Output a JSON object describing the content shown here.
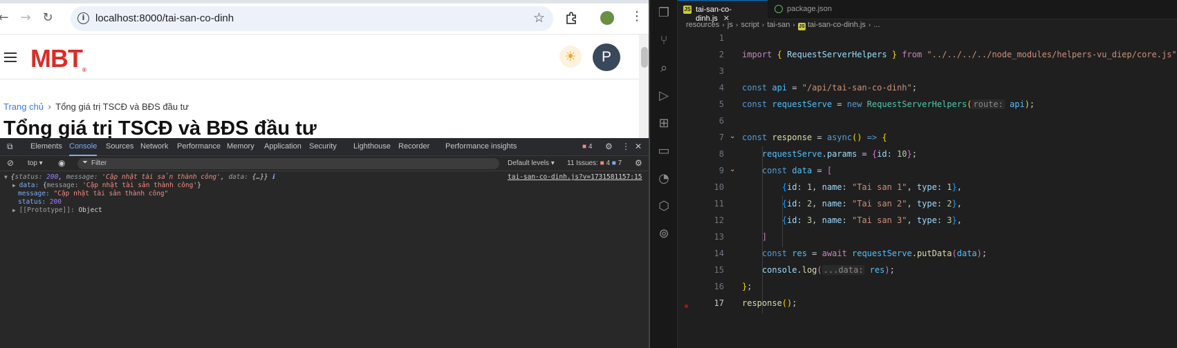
{
  "browser": {
    "url": "localhost:8000/tai-san-co-dinh",
    "page": {
      "logo_text": "MBT",
      "logo_mark": "®",
      "profile_initial": "P",
      "breadcrumb": {
        "home": "Trang chủ",
        "current": "Tổng giá trị TSCĐ và BĐS đầu tư"
      },
      "title": "Tổng giá trị TSCĐ và BĐS đầu tư"
    },
    "devtools": {
      "tabs": [
        "Elements",
        "Console",
        "Sources",
        "Network",
        "Performance",
        "Memory",
        "Application",
        "Security",
        "Lighthouse",
        "Recorder",
        "Performance insights"
      ],
      "active_tab": "Console",
      "error_badge": "4",
      "context": "top",
      "filter_placeholder": "Filter",
      "levels": "Default levels",
      "issues_label": "11 Issues:",
      "issues_errors": "4",
      "issues_info": "7",
      "console": {
        "summary_status_key": "status",
        "summary_status_val": "200",
        "summary_message_key": "message",
        "summary_message_val": "'Cập nhật tài sản thành công'",
        "summary_data_key": "data",
        "summary_data_val": "{…}",
        "source_link": "tai-san-co-dinh.js?v=1731581157:15",
        "data_line_key": "data:",
        "data_line_inner_key": "message",
        "data_line_inner_val": "'Cập nhật tài sản thành công'",
        "message_key": "message:",
        "message_val": "\"Cập nhật tài sản thành công\"",
        "status_key": "status:",
        "status_val": "200",
        "prototype_key": "[[Prototype]]:",
        "prototype_val": "Object"
      }
    }
  },
  "vscode": {
    "tabs": [
      {
        "label": "tai-san-co-dinh.js",
        "active": true
      },
      {
        "label": "package.json",
        "active": false
      }
    ],
    "breadcrumb": [
      "resources",
      "js",
      "script",
      "tai-san",
      "tai-san-co-dinh.js",
      "..."
    ],
    "line_numbers": [
      "1",
      "2",
      "3",
      "4",
      "5",
      "6",
      "7",
      "8",
      "9",
      "10",
      "11",
      "12",
      "13",
      "14",
      "15",
      "16",
      "17"
    ],
    "code": {
      "l2_import": "import",
      "l2_name": "RequestServerHelpers",
      "l2_from": "from",
      "l2_path": "\"../../../../node_modules/helpers-vu_diep/core.js\"",
      "l4_var": "api",
      "l4_val": "\"/api/tai-san-co-dinh\"",
      "l5_var": "requestServe",
      "l5_new": "new",
      "l5_cls": "RequestServerHelpers",
      "l5_hint": "route:",
      "l5_arg": "api",
      "l7_var": "response",
      "l7_async": "async",
      "l8_obj": "requestServe",
      "l8_prop": "params",
      "l8_key": "id",
      "l8_val": "10",
      "l9_var": "data",
      "rows": [
        {
          "id": "1",
          "name": "\"Tai san 1\"",
          "type": "1"
        },
        {
          "id": "2",
          "name": "\"Tai san 2\"",
          "type": "2"
        },
        {
          "id": "3",
          "name": "\"Tai san 3\"",
          "type": "3"
        }
      ],
      "l14_var": "res",
      "l14_await": "await",
      "l14_obj": "requestServe",
      "l14_fn": "putData",
      "l14_arg": "data",
      "l15_obj": "console",
      "l15_fn": "log",
      "l15_hint": "...data:",
      "l15_arg": "res",
      "l17_fn": "response"
    }
  }
}
